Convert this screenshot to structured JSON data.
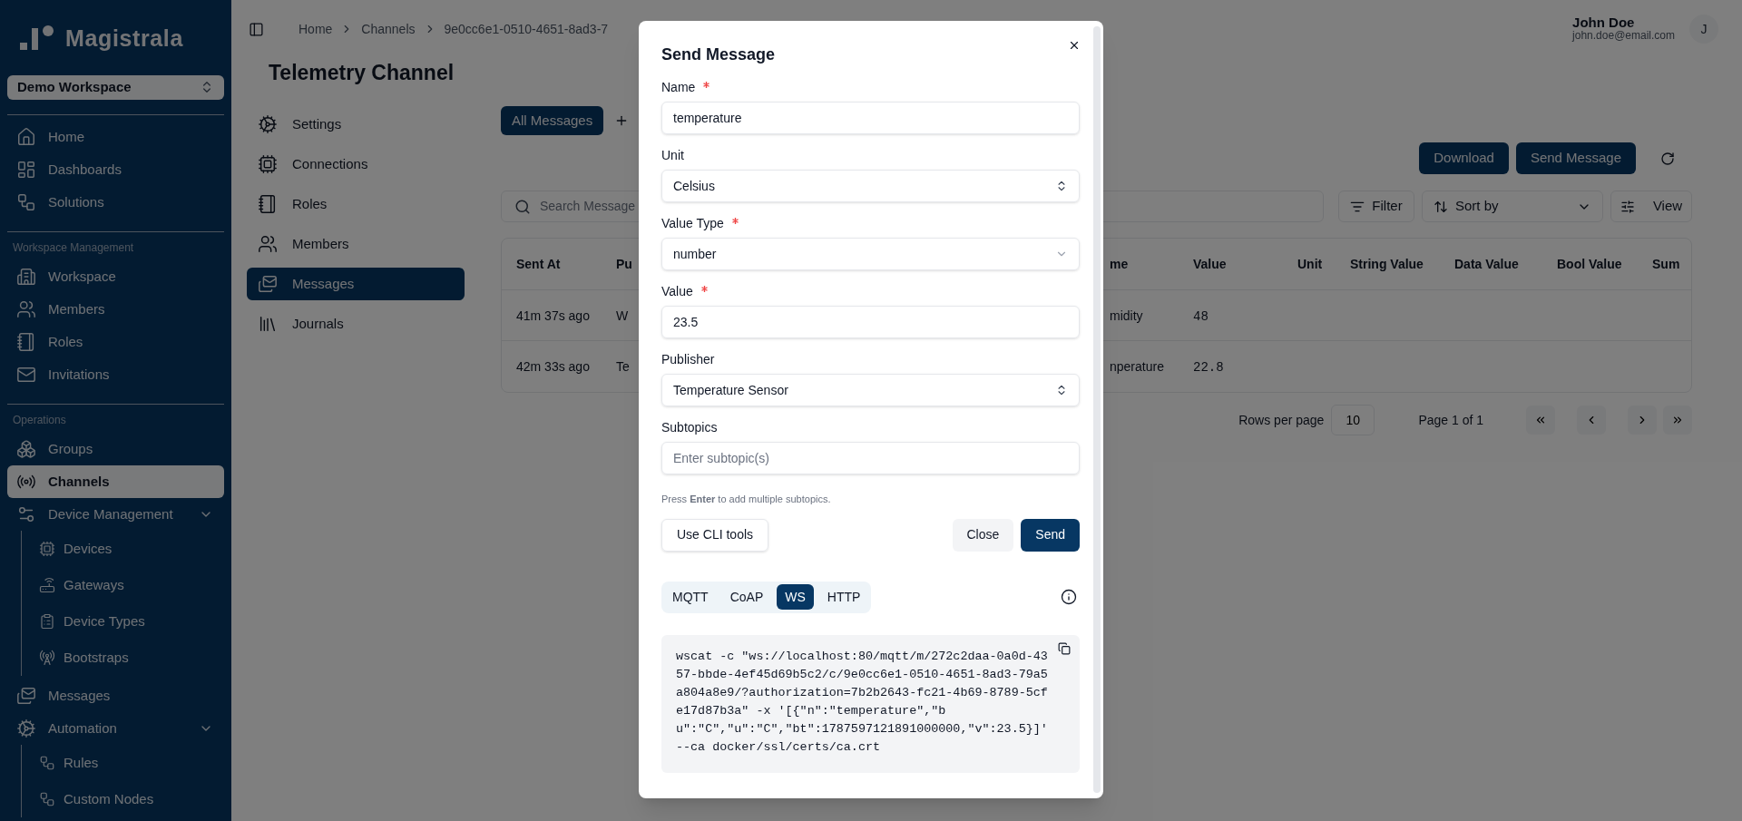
{
  "sidebar": {
    "logo": "Magistrala",
    "workspace": "Demo Workspace",
    "sections": [
      {
        "items": [
          {
            "label": "Home",
            "selected": false
          },
          {
            "label": "Dashboards",
            "selected": false
          },
          {
            "label": "Solutions",
            "selected": false
          }
        ]
      },
      {
        "heading": "Workspace Management",
        "items": [
          {
            "label": "Workspace",
            "selected": false
          },
          {
            "label": "Members",
            "selected": false
          },
          {
            "label": "Roles",
            "selected": false
          },
          {
            "label": "Invitations",
            "selected": false
          }
        ]
      },
      {
        "heading": "Operations",
        "items": [
          {
            "label": "Groups",
            "selected": false
          },
          {
            "label": "Channels",
            "selected": true
          },
          {
            "label": "Device Management",
            "selected": false,
            "expanded": true,
            "children": [
              {
                "label": "Devices",
                "selected": false
              },
              {
                "label": "Gateways",
                "selected": false
              },
              {
                "label": "Device Types",
                "selected": false
              },
              {
                "label": "Bootstraps",
                "selected": false
              }
            ]
          },
          {
            "label": "Messages",
            "selected": false
          },
          {
            "label": "Automation",
            "selected": false,
            "expanded": true,
            "children": [
              {
                "label": "Rules",
                "selected": false
              },
              {
                "label": "Custom Nodes",
                "selected": false
              }
            ]
          }
        ]
      }
    ]
  },
  "header": {
    "breadcrumb": [
      "Home",
      "Channels",
      "9e0cc6e1-0510-4651-8ad3-7"
    ],
    "user": {
      "name": "John Doe",
      "email": "john.doe@email.com",
      "initial": "J"
    }
  },
  "page": {
    "title": "Telemetry Channel",
    "nav": [
      {
        "label": "Settings",
        "selected": false
      },
      {
        "label": "Connections",
        "selected": false
      },
      {
        "label": "Roles",
        "selected": false
      },
      {
        "label": "Members",
        "selected": false
      },
      {
        "label": "Messages",
        "selected": true
      },
      {
        "label": "Journals",
        "selected": false
      }
    ],
    "message_tabs": [
      {
        "label": "All Messages",
        "selected": true
      }
    ],
    "actions": [
      "Download",
      "Send Message"
    ],
    "search": {
      "placeholder": "Search Message"
    },
    "filter": "Filter",
    "sort": "Sort by",
    "view": "View",
    "table": {
      "columns": [
        "Sent At",
        "Pu",
        "me",
        "Value",
        "Unit",
        "String Value",
        "Data Value",
        "Bool Value",
        "Sum"
      ],
      "rows": [
        {
          "cells": [
            "41m 37s ago",
            "W",
            "midity",
            "48"
          ]
        },
        {
          "cells": [
            "42m 33s ago",
            "Te",
            "nperature",
            "22.8"
          ]
        }
      ]
    },
    "pagination": {
      "rows_label": "Rows per page",
      "rows_value": "10",
      "page": "Page 1 of 1"
    }
  },
  "dialog": {
    "title": "Send Message",
    "fields": [
      {
        "label": "Name",
        "required": true,
        "kind": "text",
        "value": "temperature"
      },
      {
        "label": "Unit",
        "required": false,
        "kind": "picker",
        "value": "Celsius"
      },
      {
        "label": "Value Type",
        "required": true,
        "kind": "select",
        "value": "number"
      },
      {
        "label": "Value",
        "required": true,
        "kind": "text",
        "value": "23.5"
      },
      {
        "label": "Publisher",
        "required": false,
        "kind": "picker",
        "value": "Temperature Sensor"
      },
      {
        "label": "Subtopics",
        "required": false,
        "kind": "text",
        "placeholder": "Enter subtopic(s)"
      }
    ],
    "hint": "Press **Enter** to add multiple subtopics.",
    "cli_button": "Use CLI tools",
    "close_button": "Close",
    "send_button": "Send",
    "protocols": [
      {
        "label": "MQTT",
        "selected": false
      },
      {
        "label": "CoAP",
        "selected": false
      },
      {
        "label": "WS",
        "selected": true
      },
      {
        "label": "HTTP",
        "selected": false
      }
    ],
    "code": "wscat -c \"ws://localhost:80/mqtt/m/272c2daa-0a0d-4357-bbde-4ef45d69b5c2/c/9e0cc6e1-0510-4651-8ad3-79a5a804a8e9/?authorization=7b2b2643-fc21-4b69-8789-5cfe17d87b3a\" -x '[{\"n\":\"temperature\",\"bu\":\"C\",\"u\":\"C\",\"bt\":1787597121891000000,\"v\":23.5}]' --ca docker/ssl/certs/ca.crt"
  }
}
